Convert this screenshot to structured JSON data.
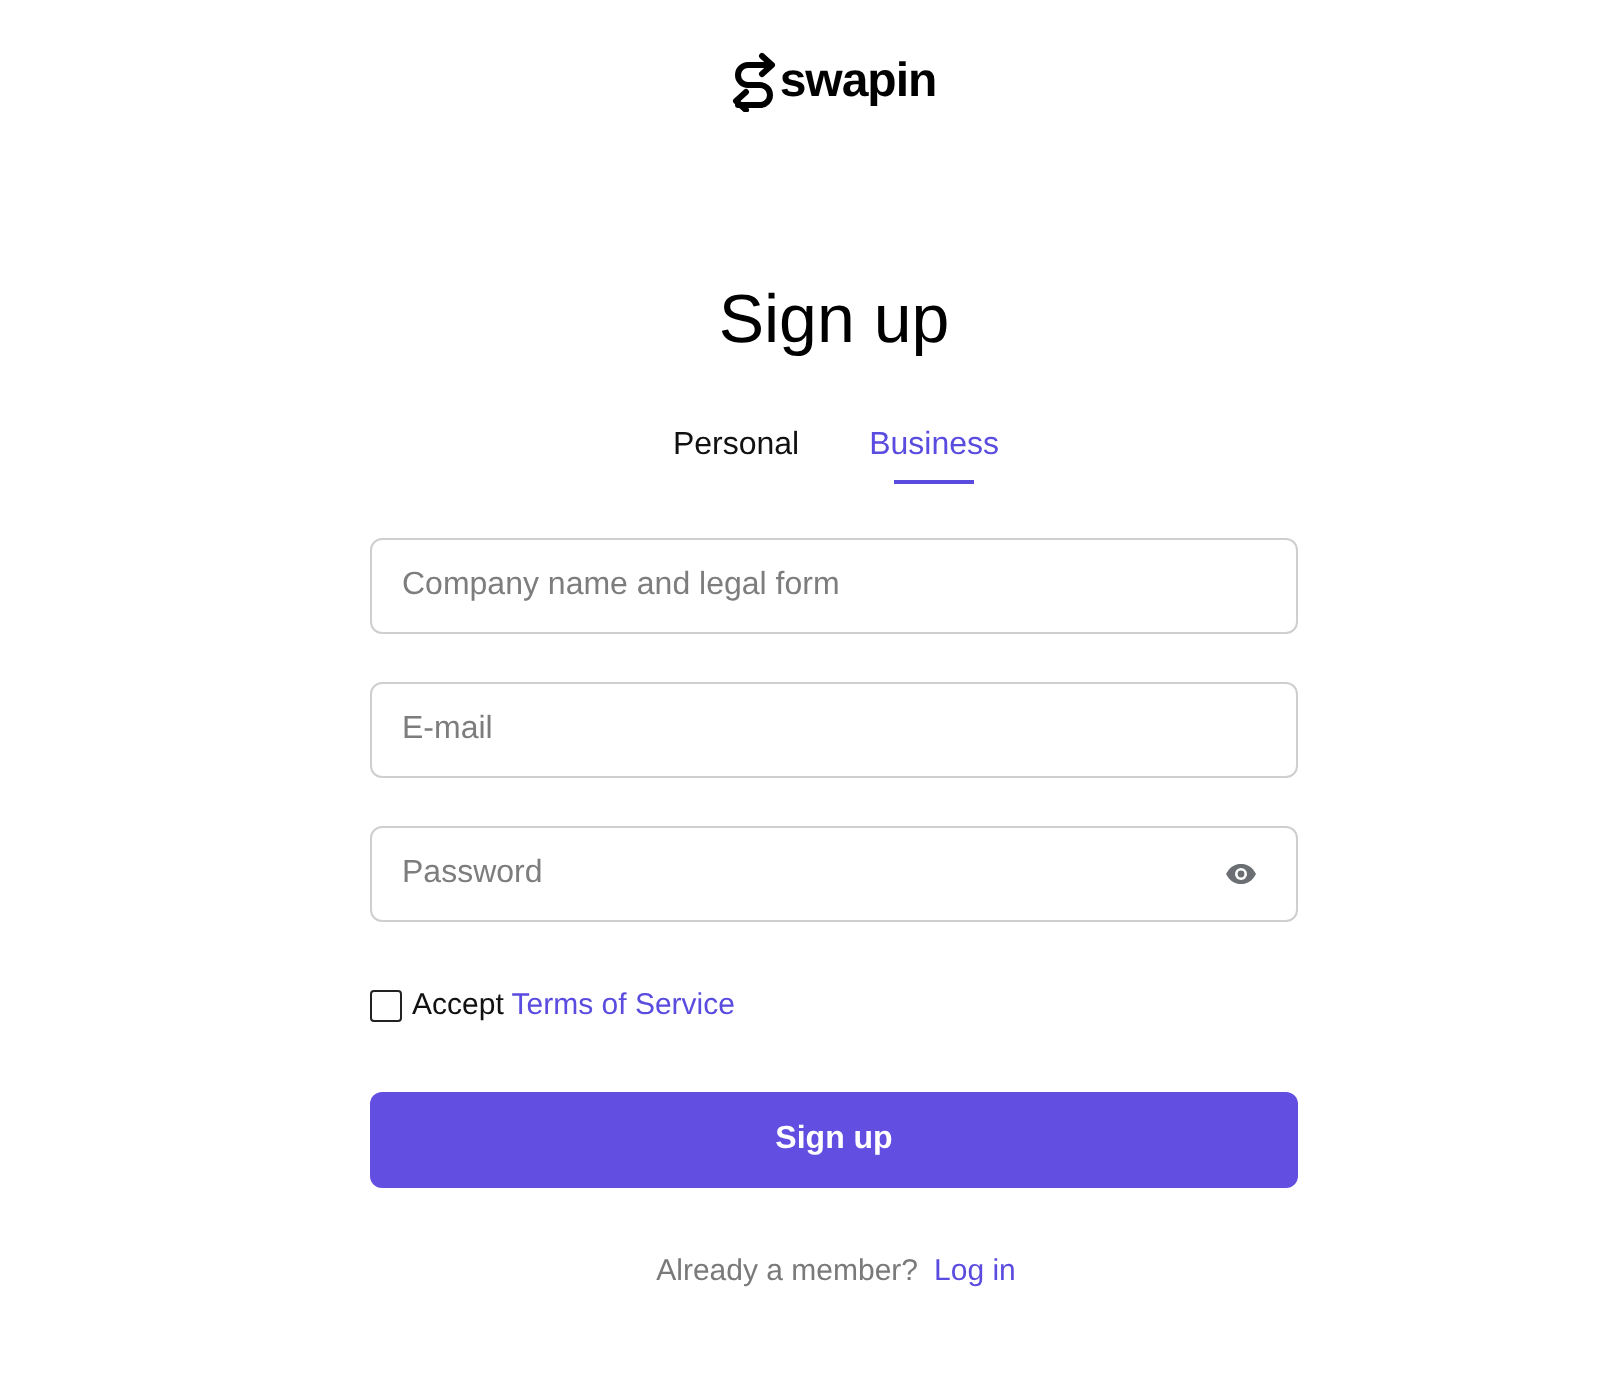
{
  "logo": {
    "text": "swapin"
  },
  "title": "Sign up",
  "tabs": [
    {
      "label": "Personal",
      "selected": false
    },
    {
      "label": "Business",
      "selected": true
    }
  ],
  "fields": [
    {
      "kind": "text",
      "placeholder": "Company name and legal form"
    },
    {
      "kind": "email",
      "placeholder": "E-mail"
    },
    {
      "kind": "password",
      "placeholder": "Password"
    }
  ],
  "terms": {
    "checked": false,
    "label": "Accept",
    "link": "Terms of Service"
  },
  "submit": {
    "label": "Sign up"
  },
  "footer": {
    "text": "Already a member?",
    "link": "Log in"
  }
}
